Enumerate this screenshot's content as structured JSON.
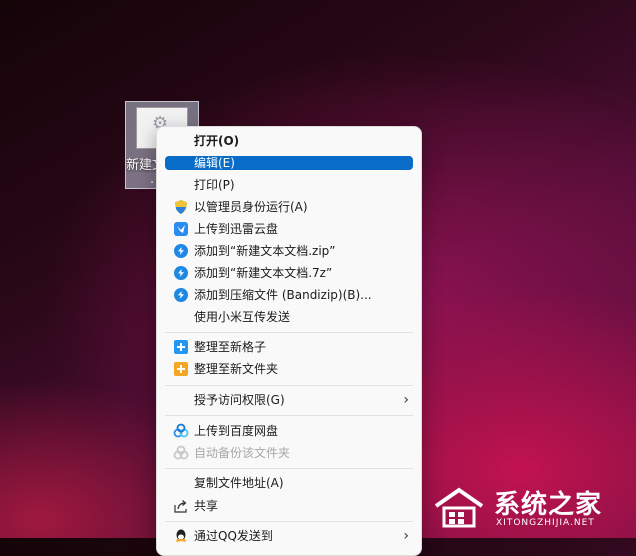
{
  "desktop_icon": {
    "label": "新建文",
    "label2": "."
  },
  "menu": {
    "items": [
      {
        "label": "打开(O)"
      },
      {
        "label": "编辑(E)"
      },
      {
        "label": "打印(P)"
      },
      {
        "label": "以管理员身份运行(A)",
        "icon": "shield-icon"
      },
      {
        "label": "上传到迅雷云盘",
        "icon": "thunder-cloud-icon"
      },
      {
        "label": "添加到“新建文本文档.zip”",
        "icon": "bandizip-icon"
      },
      {
        "label": "添加到“新建文本文档.7z”",
        "icon": "bandizip-icon"
      },
      {
        "label": "添加到压缩文件 (Bandizip)(B)...",
        "icon": "bandizip-icon"
      },
      {
        "label": "使用小米互传发送"
      },
      {
        "label": "整理至新格子",
        "icon": "plus-box-blue-icon"
      },
      {
        "label": "整理至新文件夹",
        "icon": "plus-box-orange-icon"
      },
      {
        "label": "授予访问权限(G)"
      },
      {
        "label": "上传到百度网盘",
        "icon": "baidu-cloud-icon"
      },
      {
        "label": "自动备份该文件夹",
        "icon": "baidu-cloud-icon"
      },
      {
        "label": "复制文件地址(A)"
      },
      {
        "label": "共享",
        "icon": "share-icon"
      },
      {
        "label": "通过QQ发送到",
        "icon": "qq-icon"
      }
    ]
  },
  "watermark": {
    "text": "系统之家",
    "url": "XITONGZHIJIA.NET"
  },
  "colors": {
    "selected": "#0a6cc9",
    "accent_blue": "#1e88e5",
    "accent_orange": "#f5a623"
  }
}
